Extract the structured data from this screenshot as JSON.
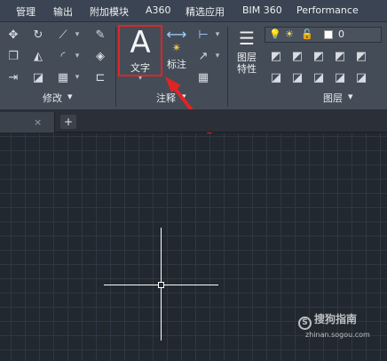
{
  "ribbon_tabs": [
    "管理",
    "输出",
    "附加模块",
    "A360",
    "精选应用",
    "BIM 360",
    "Performance"
  ],
  "modify_panel": {
    "label": "修改",
    "tools": [
      "move-icon",
      "rotate-icon",
      "trim-icon",
      "erase-icon",
      "copy-icon",
      "mirror-icon",
      "fillet-icon",
      "explode-icon",
      "stretch-icon",
      "scale-icon",
      "array-icon",
      "offset-icon"
    ]
  },
  "annotation_panel": {
    "label": "注释",
    "text_button": {
      "glyph": "A",
      "label": "文字"
    },
    "dimension_button": {
      "label": "标注"
    },
    "tools": [
      "linear-dimension-icon",
      "leader-icon",
      "table-icon"
    ]
  },
  "layers_panel": {
    "label": "图层",
    "properties_label": "图层\n特性",
    "current_layer": "0",
    "current_layer_color": "#ffffff",
    "state_icons": [
      "lightbulb-icon",
      "sun-icon",
      "unlock-icon"
    ]
  },
  "file_tabs": {
    "close_glyph": "×",
    "new_tab_glyph": "+"
  },
  "highlight_color": "#e02424",
  "watermark": {
    "logo_glyph": "S",
    "text": "搜狗指南",
    "url": "zhinan.sogou.com"
  }
}
